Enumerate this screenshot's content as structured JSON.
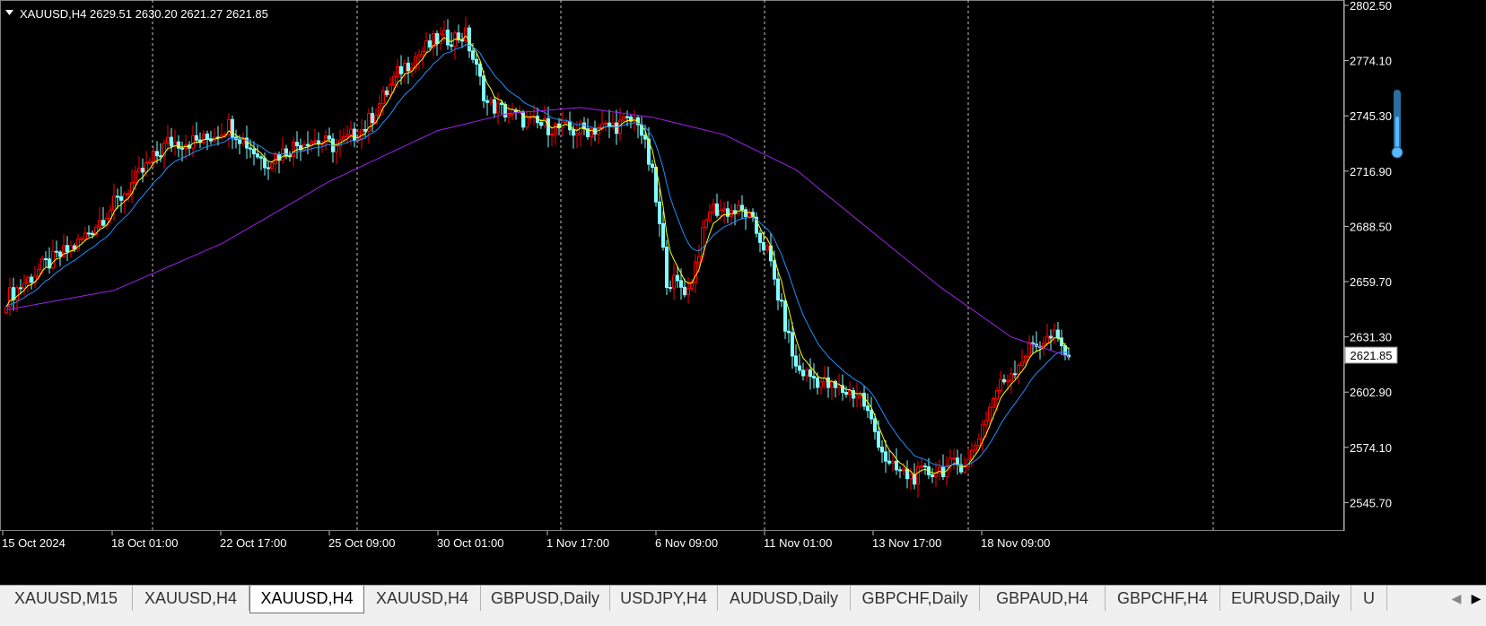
{
  "chart_header": {
    "symbol": "XAUUSD,H4",
    "ohlc": "2629.51 2630.20 2621.27 2621.85"
  },
  "price_axis": {
    "labels": [
      "2802.50",
      "2774.10",
      "2745.30",
      "2716.90",
      "2688.50",
      "2659.70",
      "2631.30",
      "2602.90",
      "2574.10",
      "2545.70"
    ],
    "current_price": 2621.85,
    "current_price_label": "2621.85"
  },
  "time_axis": {
    "labels": [
      "15 Oct 2024",
      "18 Oct 01:00",
      "22 Oct 17:00",
      "25 Oct 09:00",
      "30 Oct 01:00",
      "1 Nov 17:00",
      "6 Nov 09:00",
      "11 Nov 01:00",
      "13 Nov 17:00",
      "18 Nov 09:00"
    ]
  },
  "colors": {
    "background": "#000000",
    "bull_candle": "#ff0000",
    "bear_candle": "#7fffff",
    "ma_fast": "#ffff00",
    "ma_medium": "#1e90ff",
    "ma_slow": "#a020f0",
    "grid": "#c0c0c0",
    "axis_text": "#ffffff"
  },
  "chart_data": {
    "type": "candlestick",
    "title": "XAUUSD,H4",
    "ylim": [
      2532,
      2802.5
    ],
    "grid": "vertical dashed separators",
    "price_path": [
      {
        "i": 0,
        "p": 2652
      },
      {
        "i": 10,
        "p": 2668
      },
      {
        "i": 20,
        "p": 2680
      },
      {
        "i": 30,
        "p": 2700
      },
      {
        "i": 45,
        "p": 2732
      },
      {
        "i": 55,
        "p": 2733
      },
      {
        "i": 62,
        "p": 2741
      },
      {
        "i": 72,
        "p": 2722
      },
      {
        "i": 84,
        "p": 2734
      },
      {
        "i": 92,
        "p": 2730
      },
      {
        "i": 100,
        "p": 2740
      },
      {
        "i": 110,
        "p": 2770
      },
      {
        "i": 120,
        "p": 2785
      },
      {
        "i": 128,
        "p": 2787
      },
      {
        "i": 134,
        "p": 2752
      },
      {
        "i": 146,
        "p": 2742
      },
      {
        "i": 158,
        "p": 2738
      },
      {
        "i": 168,
        "p": 2740
      },
      {
        "i": 176,
        "p": 2744
      },
      {
        "i": 180,
        "p": 2715
      },
      {
        "i": 184,
        "p": 2662
      },
      {
        "i": 190,
        "p": 2656
      },
      {
        "i": 196,
        "p": 2698
      },
      {
        "i": 206,
        "p": 2696
      },
      {
        "i": 212,
        "p": 2676
      },
      {
        "i": 220,
        "p": 2616
      },
      {
        "i": 230,
        "p": 2606
      },
      {
        "i": 238,
        "p": 2602
      },
      {
        "i": 246,
        "p": 2565
      },
      {
        "i": 252,
        "p": 2560
      },
      {
        "i": 262,
        "p": 2565
      },
      {
        "i": 268,
        "p": 2568
      },
      {
        "i": 276,
        "p": 2605
      },
      {
        "i": 286,
        "p": 2628
      },
      {
        "i": 292,
        "p": 2632
      },
      {
        "i": 296,
        "p": 2621.85
      }
    ],
    "ma_slow_path": [
      {
        "i": 0,
        "p": 2646
      },
      {
        "i": 30,
        "p": 2656
      },
      {
        "i": 60,
        "p": 2680
      },
      {
        "i": 90,
        "p": 2712
      },
      {
        "i": 120,
        "p": 2738
      },
      {
        "i": 140,
        "p": 2747
      },
      {
        "i": 160,
        "p": 2750
      },
      {
        "i": 180,
        "p": 2745
      },
      {
        "i": 200,
        "p": 2736
      },
      {
        "i": 220,
        "p": 2718
      },
      {
        "i": 240,
        "p": 2688
      },
      {
        "i": 260,
        "p": 2658
      },
      {
        "i": 280,
        "p": 2632
      },
      {
        "i": 296,
        "p": 2622
      }
    ]
  },
  "tabs": [
    {
      "label": "XAUUSD,M15",
      "active": false
    },
    {
      "label": "XAUUSD,H4",
      "active": false
    },
    {
      "label": "XAUUSD,H4",
      "active": true
    },
    {
      "label": "XAUUSD,H4",
      "active": false
    },
    {
      "label": "GBPUSD,Daily",
      "active": false
    },
    {
      "label": "USDJPY,H4",
      "active": false
    },
    {
      "label": "AUDUSD,Daily",
      "active": false
    },
    {
      "label": "GBPCHF,Daily",
      "active": false
    },
    {
      "label": "GBPAUD,H4",
      "active": false
    },
    {
      "label": "GBPCHF,H4",
      "active": false
    },
    {
      "label": "EURUSD,Daily",
      "active": false
    },
    {
      "label": "U",
      "active": false
    }
  ],
  "tab_nav": {
    "left_arrow": "◀",
    "right_arrow": "▶"
  }
}
